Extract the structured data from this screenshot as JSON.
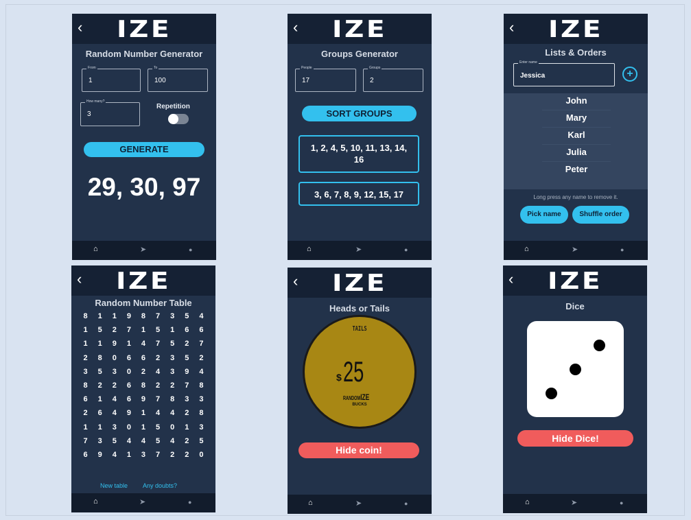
{
  "app": {
    "logo": "IZE",
    "back": "‹"
  },
  "nav": {
    "home_icon": "home-icon",
    "send_icon": "navigation-icon",
    "settings_icon": "circle-icon",
    "home": "⌂",
    "send": "➤",
    "dot": "●"
  },
  "screens": {
    "rng": {
      "title": "Random Number Generator",
      "from_label": "From",
      "from_value": "1",
      "to_label": "To",
      "to_value": "100",
      "howmany_label": "How many?",
      "howmany_value": "3",
      "repetition_label": "Repetition",
      "generate_label": "GENERATE",
      "result": "29, 30, 97"
    },
    "groups": {
      "title": "Groups Generator",
      "people_label": "People",
      "people_value": "17",
      "groups_label": "Groups",
      "groups_value": "2",
      "sort_label": "SORT GROUPS",
      "group1": "1, 2, 4, 5, 10, 11, 13, 14, 16",
      "group2": "3, 6, 7, 8, 9, 12, 15, 17"
    },
    "lists": {
      "title": "Lists & Orders",
      "name_label": "Enter name",
      "name_value": "Jessica",
      "add_icon": "plus-circle-icon",
      "names": [
        "John",
        "Mary",
        "Karl",
        "Julia",
        "Peter"
      ],
      "hint": "Long press any name to remove it.",
      "pick_label": "Pick name",
      "shuffle_label": "Shuffle order"
    },
    "table": {
      "title": "Random Number Table",
      "rows": [
        [
          "8",
          "1",
          "1",
          "9",
          "8",
          "7",
          "3",
          "5",
          "4"
        ],
        [
          "1",
          "5",
          "2",
          "7",
          "1",
          "5",
          "1",
          "6",
          "6"
        ],
        [
          "1",
          "1",
          "9",
          "1",
          "4",
          "7",
          "5",
          "2",
          "7"
        ],
        [
          "2",
          "8",
          "0",
          "6",
          "6",
          "2",
          "3",
          "5",
          "2"
        ],
        [
          "3",
          "5",
          "3",
          "0",
          "2",
          "4",
          "3",
          "9",
          "4"
        ],
        [
          "8",
          "2",
          "2",
          "6",
          "8",
          "2",
          "2",
          "7",
          "8"
        ],
        [
          "6",
          "1",
          "4",
          "6",
          "9",
          "7",
          "8",
          "3",
          "3"
        ],
        [
          "2",
          "6",
          "4",
          "9",
          "1",
          "4",
          "4",
          "2",
          "8"
        ],
        [
          "1",
          "1",
          "3",
          "0",
          "1",
          "5",
          "0",
          "1",
          "3"
        ],
        [
          "7",
          "3",
          "5",
          "4",
          "4",
          "5",
          "4",
          "2",
          "5"
        ],
        [
          "6",
          "9",
          "4",
          "1",
          "3",
          "7",
          "2",
          "2",
          "0"
        ]
      ],
      "new_table_label": "New table",
      "doubts_label": "Any doubts?"
    },
    "coin": {
      "title": "Heads or Tails",
      "side": "TAILS",
      "currency": "$",
      "amount": "25",
      "brand_prefix": "RANDOM",
      "brand_suffix": "IZE",
      "brand_sub": "BUCKS",
      "hide_label": "Hide coin!"
    },
    "dice": {
      "title": "Dice",
      "value": 3,
      "hide_label": "Hide Dice!"
    }
  },
  "colors": {
    "background": "#d9e3f1",
    "screen": "#22324a",
    "topbar": "#152134",
    "accent": "#33c0ee",
    "danger": "#f05c5c",
    "coin": "#a88714"
  }
}
